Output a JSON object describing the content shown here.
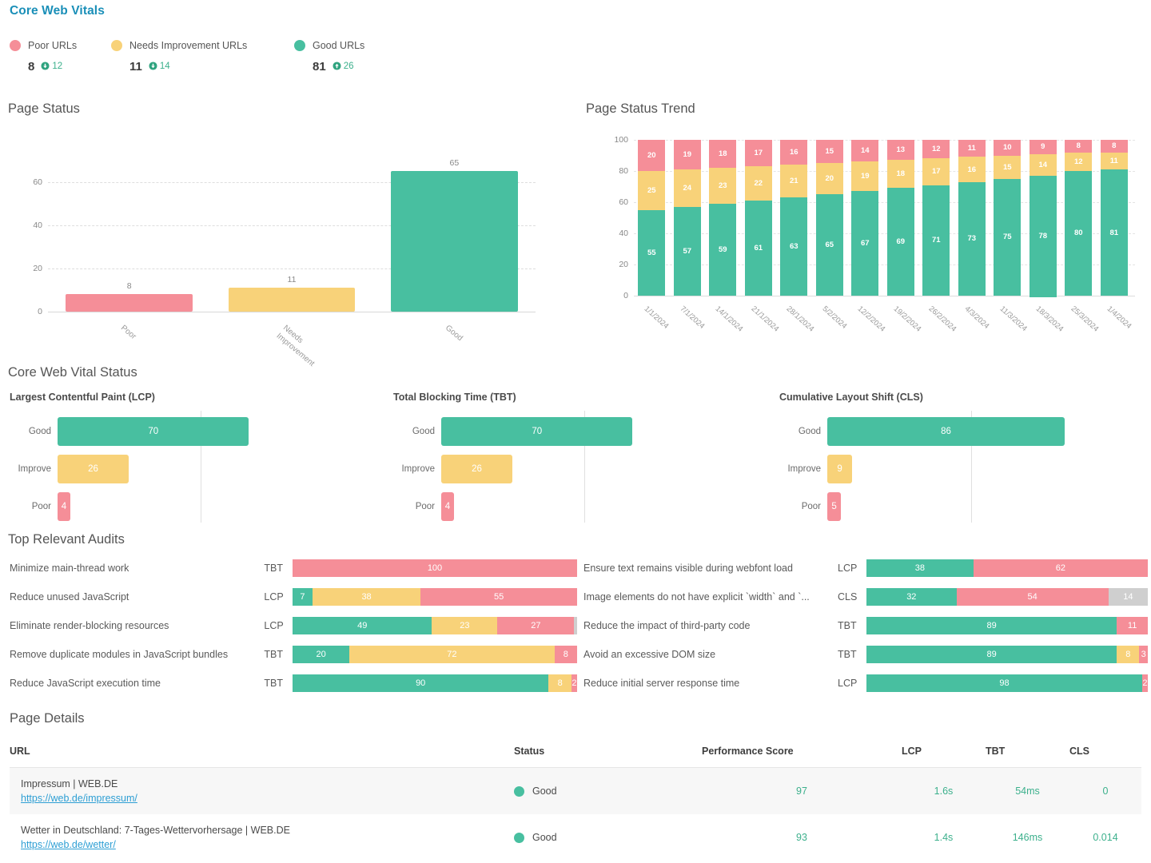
{
  "colors": {
    "poor": "#f58e98",
    "needs": "#f8d279",
    "good": "#48bfa0",
    "na": "#cfcfcf",
    "title": "#1a8fb8",
    "link": "#2e9fd4",
    "metric": "#3cb08c"
  },
  "header": {
    "title": "Core Web Vitals"
  },
  "legend": {
    "items": [
      {
        "label": "Poor URLs",
        "value": "8",
        "delta": "12",
        "direction": "down",
        "color": "#f58e98"
      },
      {
        "label": "Needs Improvement URLs",
        "value": "11",
        "delta": "14",
        "direction": "down",
        "color": "#f8d279"
      },
      {
        "label": "Good URLs",
        "value": "81",
        "delta": "26",
        "direction": "up",
        "color": "#48bfa0"
      }
    ]
  },
  "sections": {
    "page_status": "Page Status",
    "page_status_trend": "Page Status Trend",
    "cwv_status": "Core Web Vital Status",
    "top_audits": "Top Relevant Audits",
    "page_details": "Page Details"
  },
  "chart_data": [
    {
      "type": "bar",
      "title": "Page Status",
      "categories": [
        "Poor",
        "Needs Improvement",
        "Good"
      ],
      "values": [
        8,
        11,
        65
      ],
      "colors": [
        "#f58e98",
        "#f8d279",
        "#48bfa0"
      ],
      "yticks": [
        0,
        20,
        40,
        60
      ],
      "ylim": [
        0,
        72
      ],
      "xlabel": "",
      "ylabel": "",
      "grid": true
    },
    {
      "type": "bar",
      "stacked": true,
      "title": "Page Status Trend",
      "categories": [
        "1/1/2024",
        "7/1/2024",
        "14/1/2024",
        "21/1/2024",
        "28/1/2024",
        "5/2/2024",
        "12/2/2024",
        "19/2/2024",
        "26/2/2024",
        "4/3/2024",
        "11/3/2024",
        "18/3/2024",
        "25/3/2024",
        "1/4/2024"
      ],
      "series": [
        {
          "name": "Good",
          "color": "#48bfa0",
          "values": [
            55,
            57,
            59,
            61,
            63,
            65,
            67,
            69,
            71,
            73,
            75,
            78,
            80,
            81
          ]
        },
        {
          "name": "Needs Improvement",
          "color": "#f8d279",
          "values": [
            25,
            24,
            23,
            22,
            21,
            20,
            19,
            18,
            17,
            16,
            15,
            14,
            12,
            11
          ]
        },
        {
          "name": "Poor",
          "color": "#f58e98",
          "values": [
            20,
            19,
            18,
            17,
            16,
            15,
            14,
            13,
            12,
            11,
            10,
            9,
            8,
            8
          ]
        }
      ],
      "yticks": [
        0,
        20,
        40,
        60,
        80,
        100
      ],
      "ylim": [
        0,
        100
      ],
      "grid": true
    }
  ],
  "cwv_status": {
    "axis_max": 95,
    "gridline_at": 55,
    "panels": [
      {
        "heading": "Largest Contentful Paint (LCP)",
        "rows": [
          {
            "label": "Good",
            "value": "70",
            "num": 70,
            "color": "#48bfa0"
          },
          {
            "label": "Improve",
            "value": "26",
            "num": 26,
            "color": "#f8d279"
          },
          {
            "label": "Poor",
            "value": "4",
            "num": 4,
            "color": "#f58e98"
          }
        ]
      },
      {
        "heading": "Total Blocking Time (TBT)",
        "rows": [
          {
            "label": "Good",
            "value": "70",
            "num": 70,
            "color": "#48bfa0"
          },
          {
            "label": "Improve",
            "value": "26",
            "num": 26,
            "color": "#f8d279"
          },
          {
            "label": "Poor",
            "value": "4",
            "num": 4,
            "color": "#f58e98"
          }
        ]
      },
      {
        "heading": "Cumulative Layout Shift (CLS)",
        "rows": [
          {
            "label": "Good",
            "value": "86",
            "num": 86,
            "color": "#48bfa0"
          },
          {
            "label": "Improve",
            "value": "9",
            "num": 9,
            "color": "#f8d279"
          },
          {
            "label": "Poor",
            "value": "5",
            "num": 5,
            "color": "#f58e98"
          }
        ]
      }
    ]
  },
  "audits": {
    "left": [
      {
        "name": "Minimize main-thread work",
        "metric": "TBT",
        "segments": [
          {
            "value": "100",
            "num": 100,
            "color": "#f58e98"
          }
        ]
      },
      {
        "name": "Reduce unused JavaScript",
        "metric": "LCP",
        "segments": [
          {
            "value": "7",
            "num": 7,
            "color": "#48bfa0"
          },
          {
            "value": "38",
            "num": 38,
            "color": "#f8d279"
          },
          {
            "value": "55",
            "num": 55,
            "color": "#f58e98"
          }
        ]
      },
      {
        "name": "Eliminate render-blocking resources",
        "metric": "LCP",
        "segments": [
          {
            "value": "49",
            "num": 49,
            "color": "#48bfa0"
          },
          {
            "value": "23",
            "num": 23,
            "color": "#f8d279"
          },
          {
            "value": "27",
            "num": 27,
            "color": "#f58e98"
          },
          {
            "value": "",
            "num": 1,
            "color": "#cfcfcf"
          }
        ]
      },
      {
        "name": "Remove duplicate modules in JavaScript bundles",
        "metric": "TBT",
        "segments": [
          {
            "value": "20",
            "num": 20,
            "color": "#48bfa0"
          },
          {
            "value": "72",
            "num": 72,
            "color": "#f8d279"
          },
          {
            "value": "8",
            "num": 8,
            "color": "#f58e98"
          }
        ]
      },
      {
        "name": "Reduce JavaScript execution time",
        "metric": "TBT",
        "segments": [
          {
            "value": "90",
            "num": 90,
            "color": "#48bfa0"
          },
          {
            "value": "8",
            "num": 8,
            "color": "#f8d279"
          },
          {
            "value": "2",
            "num": 2,
            "color": "#f58e98"
          }
        ]
      }
    ],
    "right": [
      {
        "name": "Ensure text remains visible during webfont load",
        "metric": "LCP",
        "segments": [
          {
            "value": "38",
            "num": 38,
            "color": "#48bfa0"
          },
          {
            "value": "62",
            "num": 62,
            "color": "#f58e98"
          }
        ]
      },
      {
        "name": "Image elements do not have explicit `width` and `...",
        "metric": "CLS",
        "segments": [
          {
            "value": "32",
            "num": 32,
            "color": "#48bfa0"
          },
          {
            "value": "54",
            "num": 54,
            "color": "#f58e98"
          },
          {
            "value": "14",
            "num": 14,
            "color": "#cfcfcf"
          }
        ]
      },
      {
        "name": "Reduce the impact of third-party code",
        "metric": "TBT",
        "segments": [
          {
            "value": "89",
            "num": 89,
            "color": "#48bfa0"
          },
          {
            "value": "11",
            "num": 11,
            "color": "#f58e98"
          }
        ]
      },
      {
        "name": "Avoid an excessive DOM size",
        "metric": "TBT",
        "segments": [
          {
            "value": "89",
            "num": 89,
            "color": "#48bfa0"
          },
          {
            "value": "8",
            "num": 8,
            "color": "#f8d279"
          },
          {
            "value": "3",
            "num": 3,
            "color": "#f58e98"
          }
        ]
      },
      {
        "name": "Reduce initial server response time",
        "metric": "LCP",
        "segments": [
          {
            "value": "98",
            "num": 98,
            "color": "#48bfa0"
          },
          {
            "value": "2",
            "num": 2,
            "color": "#f58e98"
          }
        ]
      }
    ]
  },
  "details": {
    "columns": [
      "URL",
      "Status",
      "Performance Score",
      "LCP",
      "TBT",
      "CLS"
    ],
    "rows": [
      {
        "title": "Impressum | WEB.DE",
        "url": "https://web.de/impressum/",
        "status": "Good",
        "status_color": "#48bfa0",
        "performance": "97",
        "lcp": "1.6s",
        "tbt": "54ms",
        "cls": "0"
      },
      {
        "title": "Wetter in Deutschland: 7-Tages-Wettervorhersage | WEB.DE",
        "url": "https://web.de/wetter/",
        "status": "Good",
        "status_color": "#48bfa0",
        "performance": "93",
        "lcp": "1.4s",
        "tbt": "146ms",
        "cls": "0.014"
      }
    ]
  }
}
